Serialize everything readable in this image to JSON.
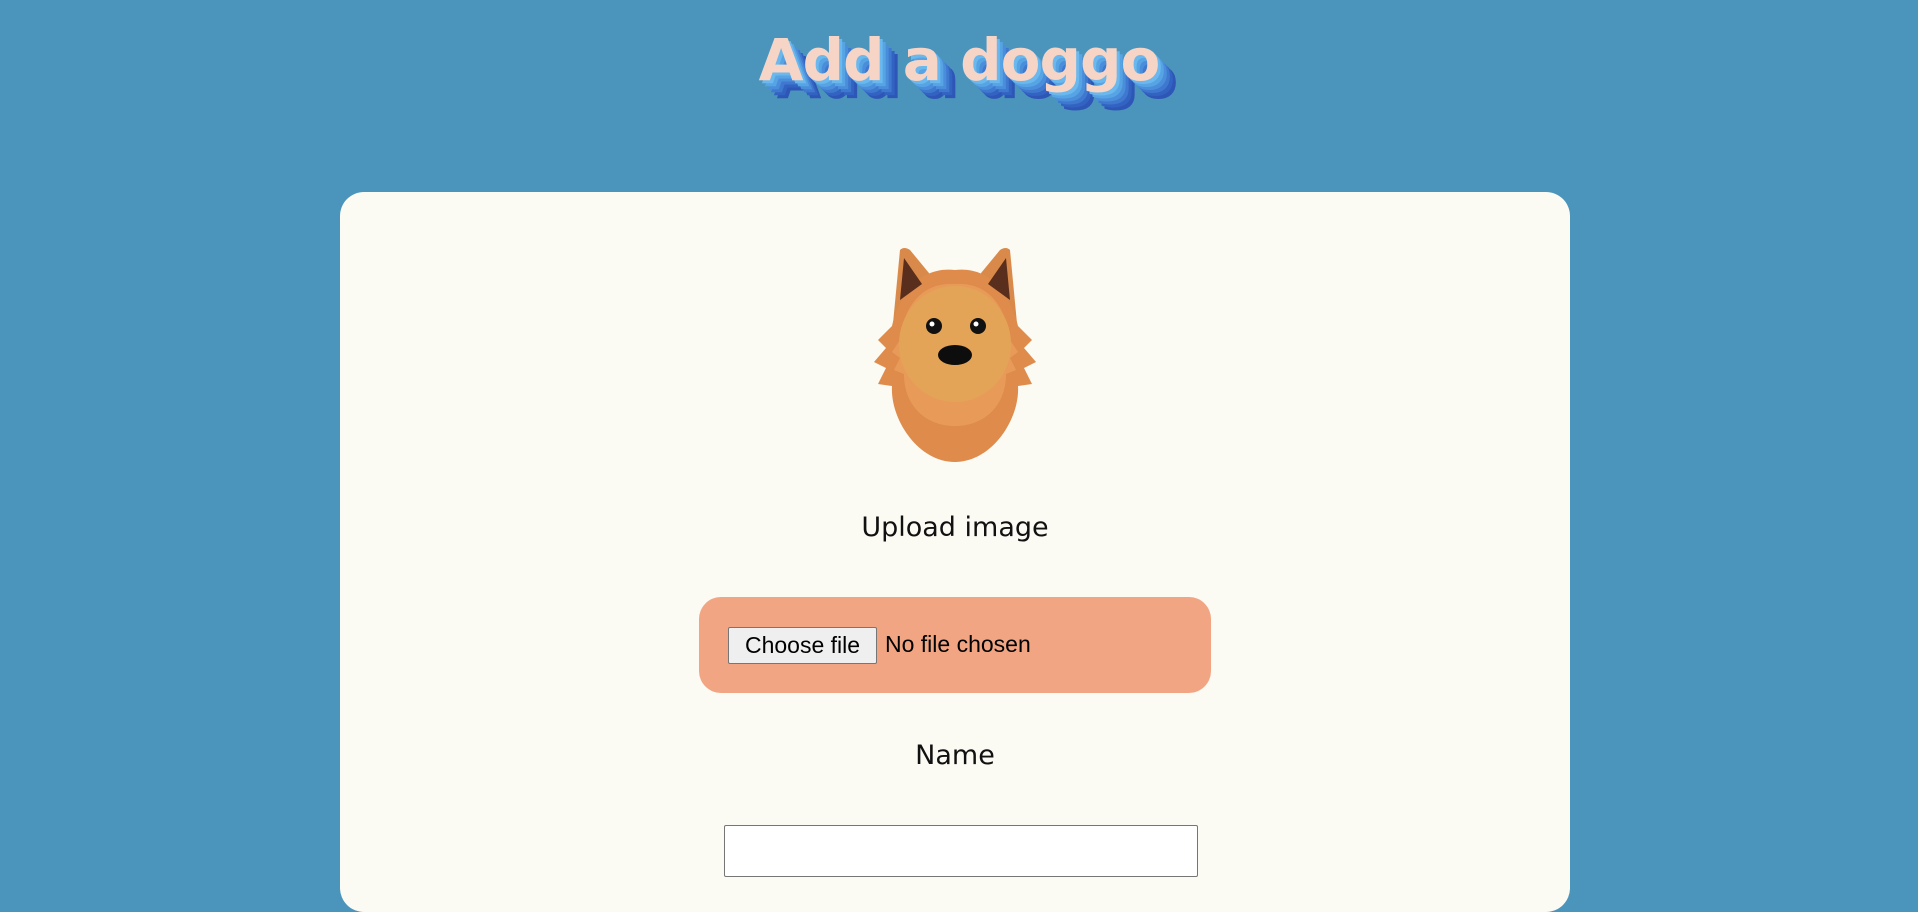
{
  "header": {
    "title": "Add a doggo"
  },
  "form": {
    "image_icon": "pomeranian-dog-face-icon",
    "upload_label": "Upload image",
    "file_input": {
      "button_label": "Choose file",
      "status": "No file chosen"
    },
    "name_label": "Name",
    "name_input": {
      "value": ""
    }
  },
  "colors": {
    "background": "#4b95bd",
    "card": "#fbfaf3",
    "title_text": "#f6d5c6",
    "title_shadow": "#3363c2",
    "file_box": "#f2a583"
  }
}
